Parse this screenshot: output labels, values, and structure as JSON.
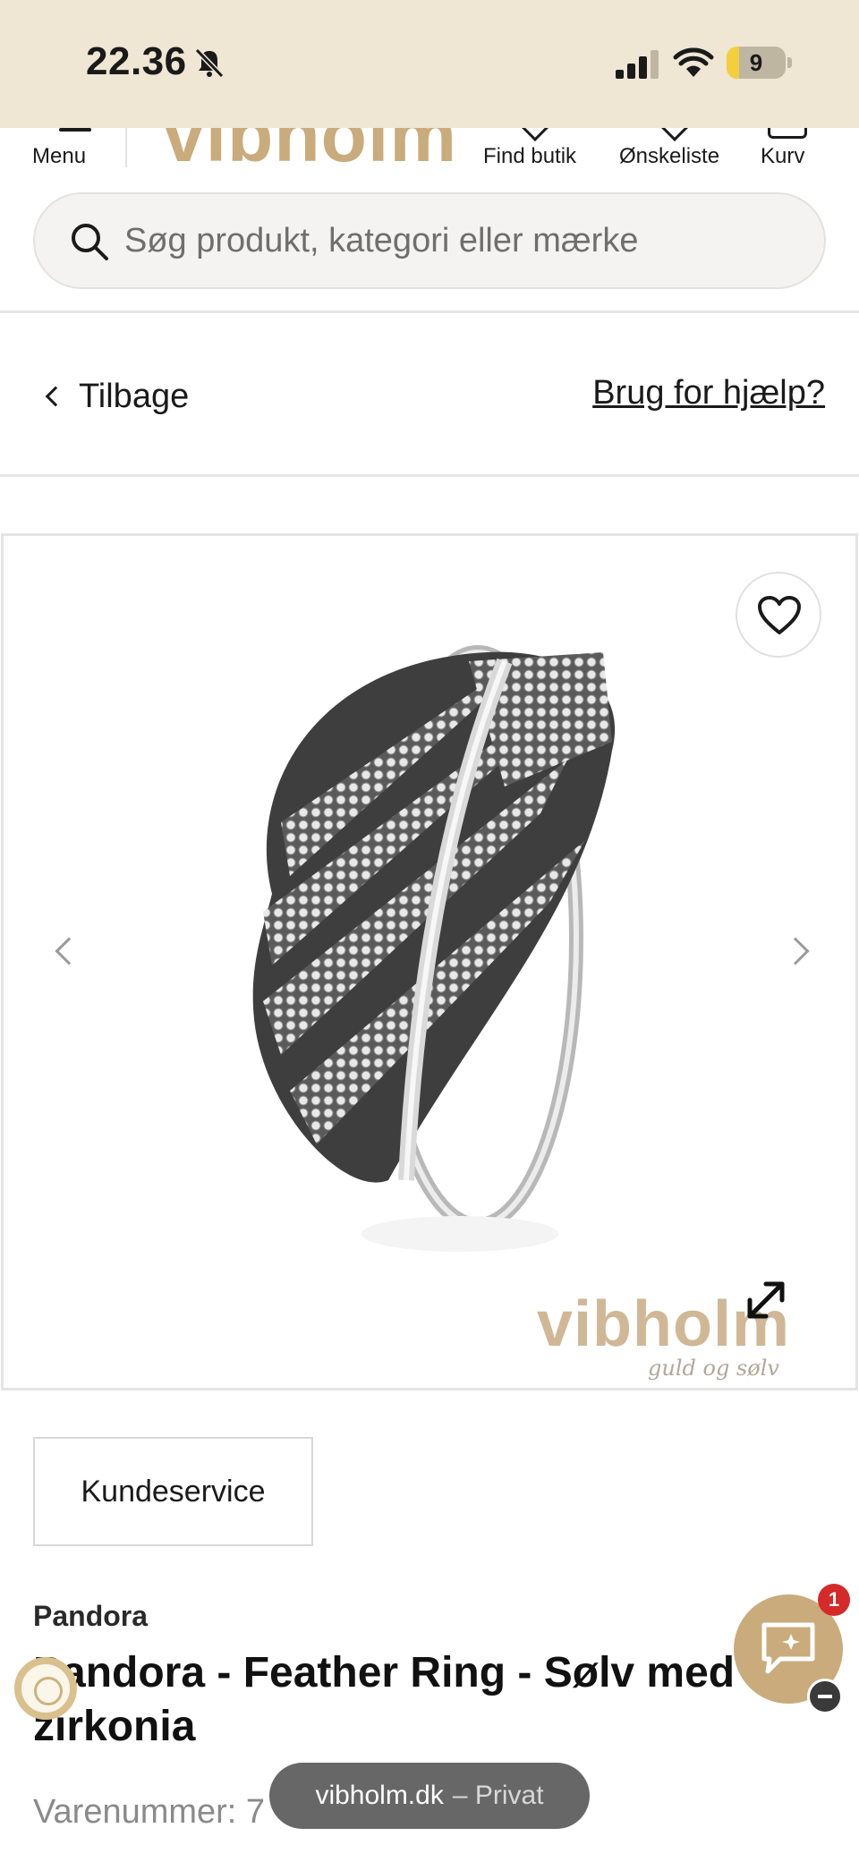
{
  "status_bar": {
    "time": "22.36",
    "battery": "9"
  },
  "header": {
    "menu_label": "Menu",
    "logo": "vibholm",
    "find_store_label": "Find butik",
    "wishlist_label": "Ønskeliste",
    "cart_label": "Kurv"
  },
  "search": {
    "placeholder": "Søg produkt, kategori eller mærke"
  },
  "nav": {
    "back_label": "Tilbage",
    "help_label": "Brug for hjælp?"
  },
  "gallery": {
    "watermark": "vibholm",
    "watermark_sub": "guld og sølv"
  },
  "product": {
    "customer_service_label": "Kundeservice",
    "brand": "Pandora",
    "title": "Pandora - Feather Ring - Sølv med zirkonia",
    "sku_label": "Varenummer: 7"
  },
  "chat": {
    "badge": "1"
  },
  "browser": {
    "domain": "vibholm.dk",
    "mode": "– Privat"
  },
  "colors": {
    "status_bar_bg": "#efe6d4",
    "brand_gold": "#c9ab7c",
    "badge_red": "#d42a2a"
  }
}
